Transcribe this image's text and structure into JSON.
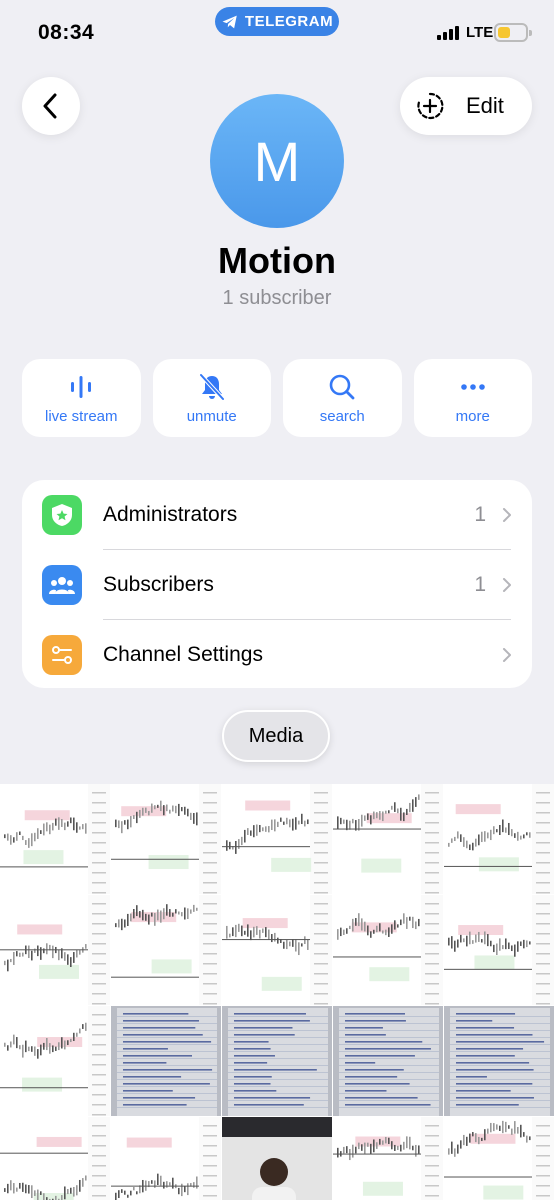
{
  "status_bar": {
    "time": "08:34",
    "app_pill": "TELEGRAM",
    "network": "LTE"
  },
  "header": {
    "edit_label": "Edit"
  },
  "profile": {
    "avatar_letter": "M",
    "name": "Motion",
    "subscribers_text": "1 subscriber",
    "avatar_color": "#5aa7f0"
  },
  "actions": [
    {
      "label": "live stream",
      "icon": "live-stream-icon"
    },
    {
      "label": "unmute",
      "icon": "bell-slash-icon"
    },
    {
      "label": "search",
      "icon": "search-icon"
    },
    {
      "label": "more",
      "icon": "more-icon"
    }
  ],
  "list": [
    {
      "label": "Administrators",
      "count": "1",
      "icon": "shield-star-icon",
      "color": "#4cd964"
    },
    {
      "label": "Subscribers",
      "count": "1",
      "icon": "people-icon",
      "color": "#3a8af0"
    },
    {
      "label": "Channel Settings",
      "count": "",
      "icon": "settings-toggle-icon",
      "color": "#f6a93b"
    }
  ],
  "media": {
    "tab_label": "Media",
    "thumbnails": [
      "chart",
      "chart",
      "chart",
      "chart",
      "chart",
      "chart",
      "chart",
      "chart",
      "chart",
      "chart",
      "chart",
      "notes",
      "notes",
      "notes",
      "notes",
      "chart",
      "chart",
      "photo",
      "chart",
      "chart"
    ]
  },
  "colors": {
    "accent": "#3478f6",
    "background": "#efeff4"
  }
}
